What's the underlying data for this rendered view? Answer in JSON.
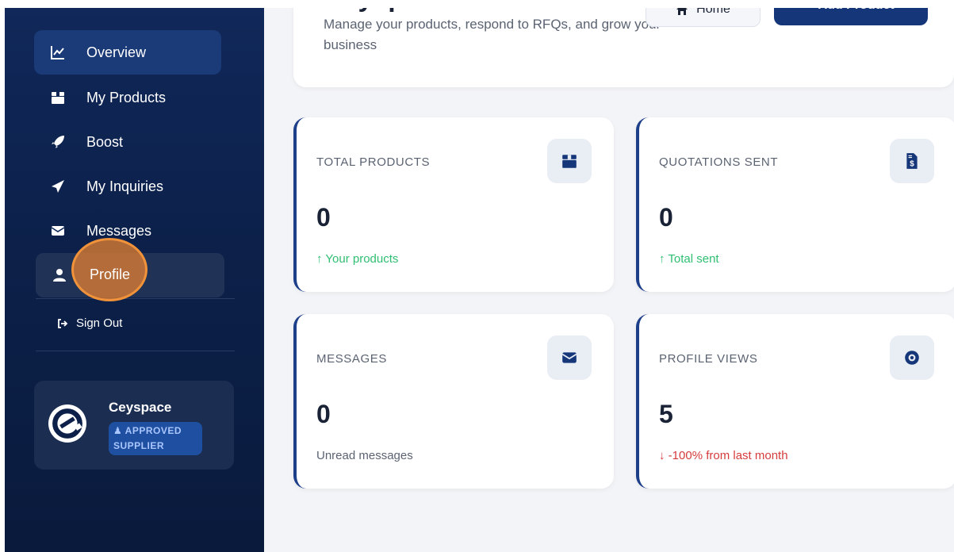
{
  "sidebar": {
    "items": [
      {
        "label": "Overview",
        "icon": "chart-line-icon"
      },
      {
        "label": "My Products",
        "icon": "box-icon"
      },
      {
        "label": "Boost",
        "icon": "rocket-icon"
      },
      {
        "label": "My Inquiries",
        "icon": "paper-plane-icon"
      },
      {
        "label": "Messages",
        "icon": "envelope-icon"
      },
      {
        "label": "Profile",
        "icon": "user-icon"
      }
    ],
    "sign_out": "Sign Out",
    "supplier": {
      "name": "Ceyspace",
      "badge_line1": "APPROVED",
      "badge_line2": "SUPPLIER"
    }
  },
  "header": {
    "title": "Ceyspace!",
    "subtitle": "Manage your products, respond to RFQs, and grow your business",
    "home_button": "Home",
    "add_button": "+ Add Product"
  },
  "stats": [
    {
      "label": "TOTAL PRODUCTS",
      "value": "0",
      "note": "↑ Your products",
      "icon": "box-icon"
    },
    {
      "label": "QUOTATIONS SENT",
      "value": "0",
      "note": "↑ Total sent",
      "icon": "invoice-dollar-icon"
    },
    {
      "label": "MESSAGES",
      "value": "0",
      "note": "Unread messages",
      "icon": "envelope-icon"
    },
    {
      "label": "PROFILE VIEWS",
      "value": "5",
      "note": "↓ -100% from last month",
      "icon": "eye-icon"
    }
  ],
  "colors": {
    "accent": "#16367a",
    "positive": "#2fbf71",
    "negative": "#d63c3c",
    "click_marker": "#f0923a"
  }
}
